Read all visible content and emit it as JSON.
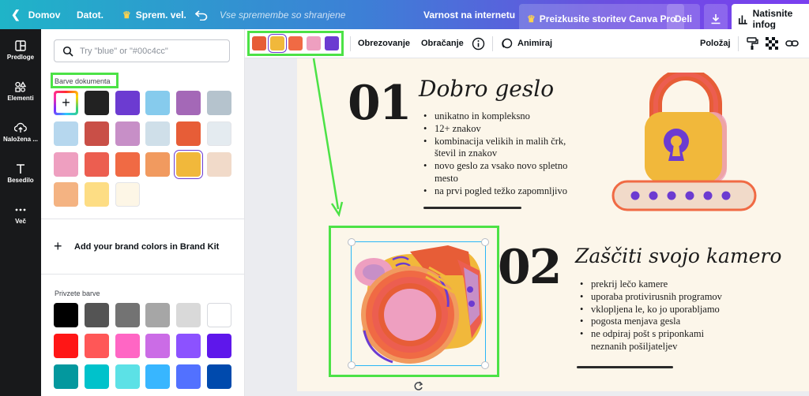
{
  "topbar": {
    "home": "Domov",
    "file": "Datot.",
    "resize": "Sprem. vel.",
    "save_status": "Vse spremembe so shranjene",
    "internet_safety": "Varnost na internetu",
    "try_pro": "Preizkusite storitev Canva Pro",
    "share": "Deli",
    "print": "Natisnite infog"
  },
  "rail": {
    "items": [
      {
        "label": "Predloge",
        "icon": "template-icon"
      },
      {
        "label": "Elementi",
        "icon": "shapes-icon"
      },
      {
        "label": "Naložena ...",
        "icon": "upload-icon"
      },
      {
        "label": "Besedilo",
        "icon": "text-icon"
      },
      {
        "label": "Več",
        "icon": "more-icon"
      }
    ]
  },
  "panel": {
    "search_placeholder": "Try \"blue\" or \"#00c4cc\"",
    "document_colors_label": "Barve dokumenta",
    "document_colors": [
      "#222222",
      "#6c3bd1",
      "#86cbed",
      "#a468b7",
      "#b5c3cd",
      "#b6d7ee",
      "#c94f47",
      "#c78fc7",
      "#cfdfe9",
      "#e75d37",
      "#e4ebf0",
      "#ee9fc0",
      "#ec5e50",
      "#f06a44",
      "#f19a5f",
      "#f1b83b",
      "#f1dac9",
      "#f4b382",
      "#fddd84",
      "#fdf6e6"
    ],
    "brand_label": "Add your brand colors in Brand Kit",
    "default_colors_label": "Privzete barve",
    "default_colors": [
      "#000000",
      "#545454",
      "#737373",
      "#a6a6a6",
      "#d9d9d9",
      "#ffffff",
      "#ff1616",
      "#ff5757",
      "#ff66c4",
      "#cb6ce6",
      "#8c52ff",
      "#5e17eb",
      "#03989e",
      "#00c2cb",
      "#5ce1e6",
      "#38b6ff",
      "#5271ff",
      "#004aad"
    ]
  },
  "ctxbar": {
    "colors": [
      "#e75d37",
      "#f1b83b",
      "#f06a44",
      "#ee9fc0",
      "#6c3bd1"
    ],
    "crop": "Obrezovanje",
    "flip": "Obračanje",
    "animate": "Animiraj",
    "position": "Položaj"
  },
  "slide": {
    "sec1": {
      "num": "01",
      "title": "Dobro geslo",
      "bullets": [
        "unikatno in kompleksno",
        "12+ znakov",
        "kombinacija velikih in malih črk,",
        "števil in znakov",
        "novo geslo za vsako novo spletno",
        "mesto",
        "na prvi pogled težko zapomnljivo"
      ]
    },
    "sec2": {
      "num": "02",
      "title": "Zaščiti svojo kamero",
      "bullets": [
        "prekrij lečo kamere",
        "uporaba protivirusnih programov",
        "vklopljena le, ko jo uporabljamo",
        "pogosta menjava gesla",
        "ne odpiraj pošt s priponkami",
        "neznanih pošiljateljev"
      ]
    }
  }
}
